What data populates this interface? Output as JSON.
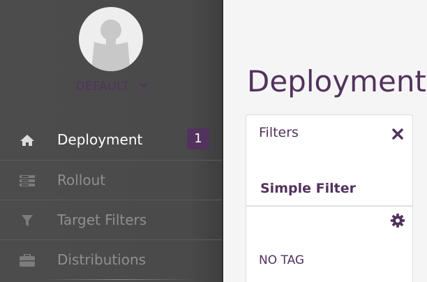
{
  "sidebar": {
    "tenant": {
      "label": "DEFAULT",
      "dropdown_icon": "chevron-down-icon"
    },
    "avatar_icon": "user-silhouette-icon",
    "items": [
      {
        "label": "Deployment",
        "icon": "home-icon",
        "active": true,
        "badge": "1"
      },
      {
        "label": "Rollout",
        "icon": "server-icon",
        "active": false
      },
      {
        "label": "Target Filters",
        "icon": "funnel-icon",
        "active": false
      },
      {
        "label": "Distributions",
        "icon": "briefcase-icon",
        "active": false
      }
    ]
  },
  "main": {
    "title": "Deployment Management",
    "filters_panel": {
      "title": "Filters",
      "close_icon": "close-icon",
      "section_title": "Simple Filter",
      "settings_icon": "gear-icon",
      "tags": [
        "NO TAG"
      ]
    }
  },
  "colors": {
    "brand": "#52325e",
    "sidebar_bg": "#4a4a4a",
    "active_text": "#ffffff",
    "inactive_text": "#8f8f8f",
    "page_bg": "#f5f5f5"
  }
}
